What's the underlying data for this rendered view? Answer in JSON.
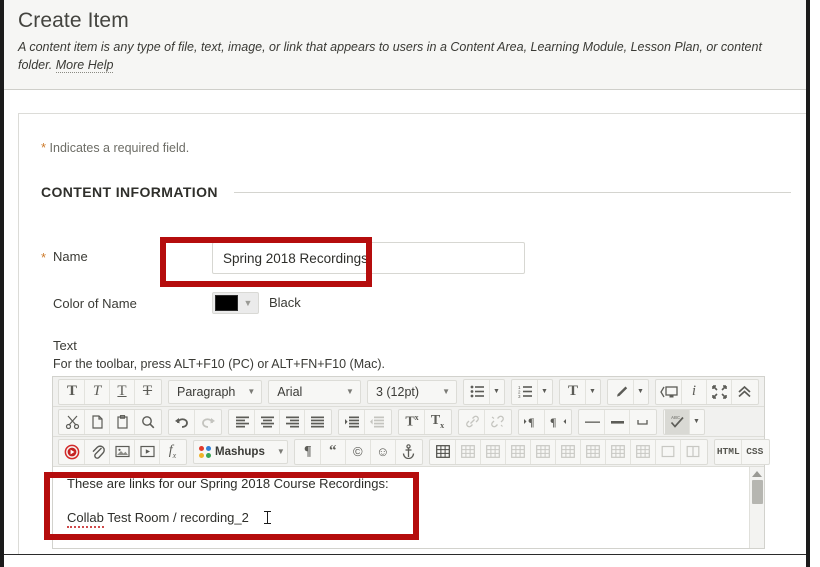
{
  "page": {
    "title": "Create Item",
    "description": "A content item is any type of file, text, image, or link that appears to users in a Content Area, Learning Module, Lesson Plan, or content folder.",
    "more_help": "More Help",
    "required_note": "Indicates a required field.",
    "required_star": "*"
  },
  "section": {
    "heading": "CONTENT INFORMATION"
  },
  "form": {
    "name": {
      "label": "Name",
      "star": "*",
      "value": "Spring 2018 Recordings",
      "placeholder": ""
    },
    "color": {
      "label": "Color of Name",
      "value": "Black",
      "swatch_hex": "#000000"
    },
    "text": {
      "label": "Text",
      "hint": "For the toolbar, press ALT+F10 (PC) or ALT+FN+F10 (Mac)."
    }
  },
  "editor": {
    "row1": {
      "format_buttons": [
        {
          "name": "bold-icon",
          "glyph": "T"
        },
        {
          "name": "italic-icon",
          "glyph": "T"
        },
        {
          "name": "underline-icon",
          "glyph": "T"
        },
        {
          "name": "strikethrough-icon",
          "glyph": "T"
        }
      ],
      "paragraph_select": "Paragraph",
      "font_select": "Arial",
      "size_select": "3 (12pt)",
      "list_buttons": [
        {
          "name": "bullet-list-icon"
        },
        {
          "name": "numbered-list-icon"
        }
      ],
      "color_buttons": [
        {
          "name": "text-color-icon",
          "glyph": "T"
        },
        {
          "name": "highlight-color-icon"
        }
      ],
      "right_buttons": [
        {
          "name": "preview-icon"
        },
        {
          "name": "info-icon",
          "glyph": "i"
        },
        {
          "name": "fullscreen-icon"
        },
        {
          "name": "collapse-toolbar-icon"
        }
      ]
    },
    "row2": {
      "clipboard": [
        {
          "name": "cut-icon"
        },
        {
          "name": "copy-icon"
        },
        {
          "name": "paste-icon"
        },
        {
          "name": "find-replace-icon"
        }
      ],
      "history": [
        {
          "name": "undo-icon"
        },
        {
          "name": "redo-icon",
          "disabled": true
        }
      ],
      "align": [
        {
          "name": "align-left-icon"
        },
        {
          "name": "align-center-icon"
        },
        {
          "name": "align-right-icon"
        },
        {
          "name": "align-justify-icon"
        }
      ],
      "indent": [
        {
          "name": "indent-icon"
        },
        {
          "name": "outdent-icon",
          "disabled": true
        }
      ],
      "script": [
        {
          "name": "superscript-icon",
          "glyph": "T"
        },
        {
          "name": "subscript-icon",
          "glyph": "T"
        }
      ],
      "link": [
        {
          "name": "insert-link-icon",
          "disabled": true
        },
        {
          "name": "remove-link-icon",
          "disabled": true
        }
      ],
      "direction": [
        {
          "name": "ltr-icon",
          "glyph": "¶"
        },
        {
          "name": "rtl-icon",
          "glyph": "¶"
        }
      ],
      "rules": [
        {
          "name": "horizontal-rule-icon"
        },
        {
          "name": "page-break-icon"
        },
        {
          "name": "nonbreaking-space-icon"
        }
      ],
      "spellcheck": {
        "name": "spellcheck-icon",
        "label": "ABC"
      }
    },
    "row3": {
      "media": [
        {
          "name": "record-icon"
        },
        {
          "name": "attach-file-icon"
        },
        {
          "name": "insert-image-icon"
        },
        {
          "name": "insert-video-icon"
        },
        {
          "name": "math-formula-icon",
          "glyph": "fx"
        }
      ],
      "mashups": {
        "name": "mashups-button",
        "label": "Mashups"
      },
      "misc": [
        {
          "name": "show-paragraph-marks-icon",
          "glyph": "¶"
        },
        {
          "name": "blockquote-icon",
          "glyph": "“"
        },
        {
          "name": "copyright-icon",
          "glyph": "©"
        },
        {
          "name": "emoticon-icon",
          "glyph": "☺"
        },
        {
          "name": "anchor-icon"
        }
      ],
      "tables": [
        {
          "name": "insert-table-icon"
        },
        {
          "name": "table-row-properties-icon",
          "disabled": true
        },
        {
          "name": "table-cell-properties-icon",
          "disabled": true
        },
        {
          "name": "insert-row-before-icon",
          "disabled": true
        },
        {
          "name": "insert-row-after-icon",
          "disabled": true
        },
        {
          "name": "delete-row-icon",
          "disabled": true
        },
        {
          "name": "insert-column-before-icon",
          "disabled": true
        },
        {
          "name": "insert-column-after-icon",
          "disabled": true
        },
        {
          "name": "delete-column-icon",
          "disabled": true
        },
        {
          "name": "merge-cells-icon",
          "disabled": true
        },
        {
          "name": "split-cell-icon",
          "disabled": true
        }
      ],
      "code": [
        {
          "name": "html-source-button",
          "label": "HTML"
        },
        {
          "name": "css-source-button",
          "label": "CSS"
        }
      ]
    },
    "body": {
      "line1": "These are links for our Spring 2018 Course Recordings:",
      "line2_link": "Collab",
      "line2_rest": " Test Room / recording_2"
    }
  },
  "highlights": {
    "accent_hex": "#b50d0d"
  }
}
